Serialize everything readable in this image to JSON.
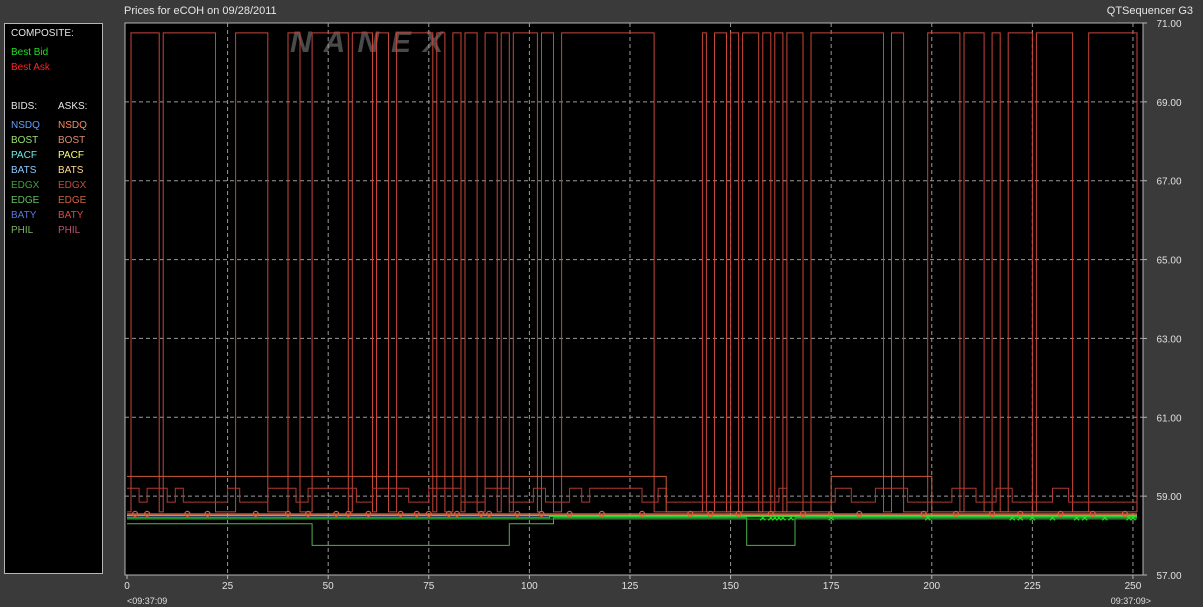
{
  "header": {
    "title": "Prices for  eCOH  on  09/28/2011",
    "product": "QTSequencer G3",
    "watermark": "NANEX"
  },
  "legend": {
    "composite_heading": "COMPOSITE:",
    "best_bid": "Best Bid",
    "best_ask": "Best Ask",
    "bids_heading": "BIDS:",
    "asks_heading": "ASKS:",
    "rows": [
      {
        "bid": "NSDQ",
        "ask": "NSDQ",
        "bid_color": "#5ea0ff",
        "ask_color": "#ff8a5a"
      },
      {
        "bid": "BOST",
        "ask": "BOST",
        "bid_color": "#9ae070",
        "ask_color": "#e08a70"
      },
      {
        "bid": "PACF",
        "ask": "PACF",
        "bid_color": "#6fe8e8",
        "ask_color": "#ffff70"
      },
      {
        "bid": "BATS",
        "ask": "BATS",
        "bid_color": "#8ec8ff",
        "ask_color": "#ffd890"
      },
      {
        "bid": "EDGX",
        "ask": "EDGX",
        "bid_color": "#40a040",
        "ask_color": "#c05038"
      },
      {
        "bid": "EDGE",
        "ask": "EDGE",
        "bid_color": "#60c060",
        "ask_color": "#d06048"
      },
      {
        "bid": "BATY",
        "ask": "BATY",
        "bid_color": "#5a78e0",
        "ask_color": "#e04848"
      },
      {
        "bid": "PHIL",
        "ask": "PHIL",
        "bid_color": "#80b060",
        "ask_color": "#c05070"
      }
    ],
    "colors": {
      "best_bid": "#22dd22",
      "best_ask": "#ff2222",
      "heading": "#e6e6e6"
    }
  },
  "time_labels": {
    "start": "<09:37:09",
    "end": "09:37:09>"
  },
  "chart_data": {
    "type": "line",
    "title": "Prices for  eCOH  on  09/28/2011",
    "xlim": [
      0,
      252
    ],
    "ylim": [
      57,
      71
    ],
    "x_ticks": [
      0,
      25,
      50,
      75,
      100,
      125,
      150,
      175,
      200,
      225,
      250
    ],
    "y_ticks": [
      57,
      59,
      61,
      63,
      65,
      67,
      69,
      71
    ],
    "y_tick_labels": [
      "57.00",
      "59.00",
      "61.00",
      "63.00",
      "65.00",
      "67.00",
      "69.00",
      "71.00"
    ],
    "grid": true,
    "series": [
      {
        "color": "#c8463a",
        "steps": [
          [
            0,
            58.6
          ],
          [
            1,
            70.75
          ],
          [
            8,
            58.6
          ],
          [
            9,
            70.75
          ],
          [
            22,
            58.6
          ],
          [
            27,
            70.75
          ],
          [
            35,
            58.6
          ],
          [
            40,
            70.75
          ],
          [
            43,
            58.6
          ],
          [
            46,
            70.75
          ],
          [
            55,
            58.6
          ],
          [
            56,
            70.75
          ],
          [
            61,
            58.6
          ],
          [
            62,
            70.75
          ],
          [
            65,
            58.6
          ],
          [
            67,
            70.75
          ],
          [
            76,
            58.6
          ],
          [
            77,
            70.75
          ],
          [
            79,
            58.6
          ],
          [
            81,
            70.75
          ],
          [
            83,
            58.6
          ],
          [
            84,
            70.75
          ],
          [
            87,
            58.6
          ],
          [
            89,
            70.75
          ],
          [
            92,
            58.6
          ],
          [
            93,
            70.75
          ],
          [
            95,
            58.6
          ],
          [
            96,
            70.75
          ],
          [
            102,
            58.6
          ],
          [
            103,
            70.75
          ],
          [
            106,
            58.6
          ],
          [
            108,
            70.75
          ],
          [
            131,
            58.6
          ],
          [
            140,
            58.6
          ],
          [
            142,
            58.6
          ],
          [
            143,
            70.75
          ],
          [
            144,
            58.6
          ],
          [
            146,
            70.75
          ],
          [
            149,
            58.6
          ],
          [
            150,
            70.75
          ],
          [
            152,
            58.6
          ],
          [
            153,
            70.75
          ],
          [
            157,
            58.6
          ],
          [
            158,
            70.75
          ],
          [
            160,
            58.6
          ],
          [
            161,
            70.75
          ],
          [
            163,
            58.6
          ],
          [
            164,
            70.75
          ],
          [
            168,
            58.6
          ],
          [
            170,
            70.75
          ],
          [
            188,
            58.6
          ],
          [
            190,
            70.75
          ],
          [
            193,
            58.6
          ],
          [
            199,
            70.75
          ],
          [
            207,
            58.6
          ],
          [
            208,
            70.75
          ],
          [
            213,
            58.6
          ],
          [
            215,
            70.75
          ],
          [
            217,
            58.6
          ],
          [
            219,
            70.75
          ],
          [
            225,
            58.6
          ],
          [
            226,
            70.75
          ],
          [
            235,
            58.6
          ],
          [
            239,
            70.75
          ],
          [
            251,
            58.6
          ]
        ]
      },
      {
        "color": "#b03a30",
        "steps": [
          [
            0,
            59.2
          ],
          [
            2,
            59.2
          ],
          [
            3,
            58.85
          ],
          [
            5,
            59.2
          ],
          [
            10,
            58.85
          ],
          [
            12,
            59.2
          ],
          [
            14,
            58.85
          ],
          [
            25,
            59.2
          ],
          [
            28,
            58.85
          ],
          [
            35,
            59.2
          ],
          [
            42,
            58.85
          ],
          [
            45,
            59.2
          ],
          [
            57,
            58.85
          ],
          [
            61,
            59.2
          ],
          [
            70,
            58.85
          ],
          [
            75,
            59.2
          ],
          [
            83,
            58.85
          ],
          [
            89,
            59.2
          ],
          [
            95,
            58.85
          ],
          [
            101,
            59.2
          ],
          [
            104,
            58.85
          ],
          [
            110,
            59.2
          ],
          [
            113,
            58.85
          ],
          [
            115,
            59.2
          ],
          [
            128,
            58.85
          ],
          [
            132,
            59.2
          ],
          [
            134,
            58.85
          ],
          [
            160,
            58.85
          ],
          [
            162,
            59.2
          ],
          [
            164,
            58.85
          ],
          [
            176,
            59.2
          ],
          [
            180,
            58.85
          ],
          [
            186,
            59.2
          ],
          [
            194,
            58.85
          ],
          [
            205,
            59.2
          ],
          [
            211,
            58.85
          ],
          [
            216,
            59.2
          ],
          [
            220,
            58.85
          ],
          [
            230,
            59.2
          ],
          [
            234,
            58.85
          ],
          [
            251,
            58.85
          ]
        ]
      },
      {
        "color": "#d05a3a",
        "steps": [
          [
            0,
            59.5
          ],
          [
            134,
            59.5
          ],
          [
            134,
            58.6
          ],
          [
            175,
            58.6
          ],
          [
            175,
            59.5
          ],
          [
            200,
            59.5
          ],
          [
            200,
            58.6
          ],
          [
            251,
            58.6
          ]
        ]
      },
      {
        "color": "#e06a40",
        "steps": [
          [
            0,
            58.55
          ],
          [
            251,
            58.55
          ]
        ]
      },
      {
        "color": "#ff8a5a",
        "steps": [
          [
            0,
            58.52
          ],
          [
            251,
            58.52
          ]
        ]
      },
      {
        "color": "#5ea0ff",
        "steps": [
          [
            0,
            58.5
          ],
          [
            251,
            58.5
          ]
        ]
      },
      {
        "color": "#22dd22",
        "steps": [
          [
            0,
            58.45
          ],
          [
            105,
            58.45
          ],
          [
            105,
            58.48
          ],
          [
            251,
            58.48
          ]
        ]
      },
      {
        "color": "#50b050",
        "steps": [
          [
            0,
            58.3
          ],
          [
            46,
            58.3
          ],
          [
            46,
            57.75
          ],
          [
            95,
            57.75
          ],
          [
            95,
            58.3
          ],
          [
            106,
            58.3
          ],
          [
            106,
            58.45
          ],
          [
            154,
            58.45
          ],
          [
            154,
            57.75
          ],
          [
            166,
            57.75
          ],
          [
            166,
            58.45
          ],
          [
            251,
            58.45
          ]
        ]
      },
      {
        "color": "#2ea02e",
        "steps": [
          [
            0,
            58.42
          ],
          [
            251,
            58.42
          ]
        ]
      }
    ],
    "ask_markers": {
      "color": "#e05a3a",
      "x": [
        2,
        5,
        15,
        20,
        32,
        40,
        45,
        52,
        55,
        60,
        68,
        72,
        75,
        80,
        82,
        88,
        90,
        97,
        103,
        110,
        118,
        128,
        140,
        145,
        152,
        160,
        168,
        175,
        182,
        198,
        206,
        215,
        222,
        232,
        240,
        248
      ]
    },
    "bid_markers": {
      "color": "#22dd22",
      "x": [
        158,
        160,
        161,
        162,
        163,
        165,
        175,
        199,
        220,
        222,
        225,
        230,
        236,
        238,
        243,
        249,
        250
      ]
    }
  }
}
